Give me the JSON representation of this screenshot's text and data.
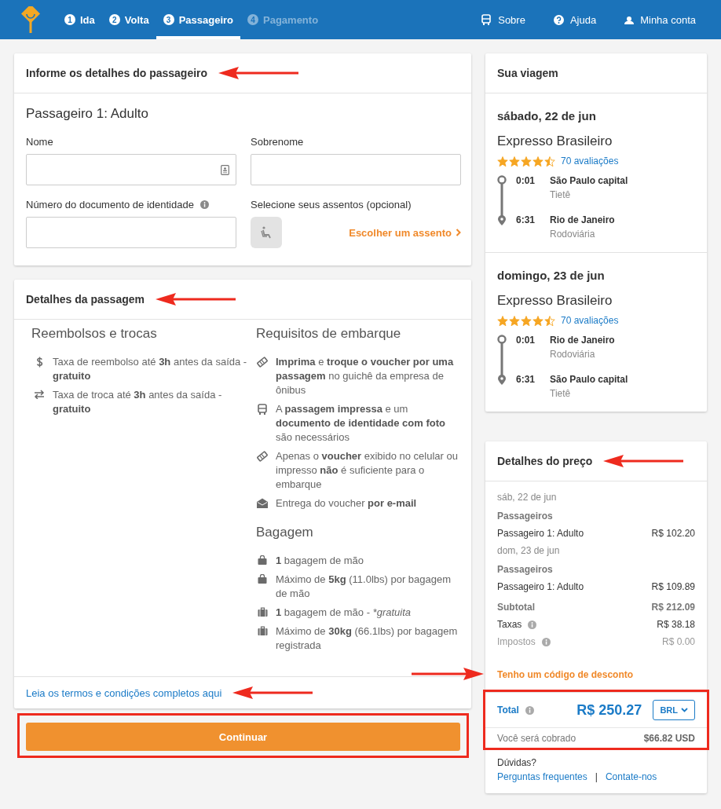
{
  "header": {
    "steps": [
      {
        "number": "1",
        "label": "Ida",
        "selected": false,
        "disabled": false
      },
      {
        "number": "2",
        "label": "Volta",
        "selected": false,
        "disabled": false
      },
      {
        "number": "3",
        "label": "Passageiro",
        "selected": true,
        "disabled": false
      },
      {
        "number": "4",
        "label": "Pagamento",
        "selected": false,
        "disabled": true
      }
    ],
    "links": [
      {
        "kind": "bus",
        "label": "Sobre"
      },
      {
        "kind": "help",
        "label": "Ajuda"
      },
      {
        "kind": "user",
        "label": "Minha conta"
      }
    ]
  },
  "passenger_form": {
    "title": "Informe os detalhes do passageiro",
    "passenger": "Passageiro 1: Adulto",
    "fields": [
      {
        "kind": "contact",
        "label": "Nome"
      },
      {
        "kind": "plain",
        "label": "Sobrenome"
      },
      {
        "kind": "info",
        "label": "Número do documento de identidade"
      }
    ],
    "seats": {
      "label": "Selecione seus assentos (opcional)",
      "link": "Escolher um assento"
    }
  },
  "ticket_details": {
    "title": "Detalhes da passagem",
    "columns": [
      [
        {
          "heading": "Reembolsos e trocas",
          "items": [
            {
              "kind": "dollar",
              "text": "Taxa de reembolso até **3h** antes da saída - **gratuito**"
            },
            {
              "kind": "swap",
              "text": "Taxa de troca até **3h** antes da saída - **gratuito**"
            }
          ]
        }
      ],
      [
        {
          "heading": "Requisitos de embarque",
          "items": [
            {
              "kind": "ticket",
              "text": "**Imprima** e **troque o voucher por uma passagem** no guichê da empresa de ônibus"
            },
            {
              "kind": "bus",
              "text": "A **passagem impressa** e um **documento de identidade com foto** são necessários"
            },
            {
              "kind": "ticket",
              "text": "Apenas o **voucher** exibido no celular ou impresso **não** é suficiente para o embarque"
            },
            {
              "kind": "mail",
              "text": "Entrega do voucher **por e-mail**"
            }
          ]
        },
        {
          "heading": "Bagagem",
          "items": [
            {
              "kind": "bag",
              "text": "**1** bagagem de mão"
            },
            {
              "kind": "bag",
              "text": "Máximo de **5kg** (11.0lbs) por bagagem de mão"
            },
            {
              "kind": "suitcase",
              "text": "**1** bagagem de mão -",
              "note": "*gratuita"
            },
            {
              "kind": "suitcase",
              "text": "Máximo de **30kg** (66.1lbs) por bagagem registrada"
            }
          ]
        }
      ]
    ],
    "terms_link": "Leia os termos e condições completos aqui"
  },
  "continue_button": "Continuar",
  "trip": {
    "title": "Sua viagem",
    "legs": [
      {
        "date": "sábado, 22 de jun",
        "company": "Expresso Brasileiro",
        "stars": 4.5,
        "reviews": "70 avaliações",
        "stops": [
          {
            "time": "0:01",
            "city": "São Paulo capital",
            "station": "Tietê"
          },
          {
            "time": "6:31",
            "city": "Rio de Janeiro",
            "station": "Rodoviária"
          }
        ]
      },
      {
        "date": "domingo, 23 de jun",
        "company": "Expresso Brasileiro",
        "stars": 4.5,
        "reviews": "70 avaliações",
        "stops": [
          {
            "time": "0:01",
            "city": "Rio de Janeiro",
            "station": "Rodoviária"
          },
          {
            "time": "6:31",
            "city": "São Paulo capital",
            "station": "Tietê"
          }
        ]
      }
    ]
  },
  "price": {
    "title": "Detalhes do preço",
    "days": [
      {
        "date": "sáb, 22 de jun",
        "group": "Passageiros",
        "lines": [
          {
            "label": "Passageiro 1: Adulto",
            "amount": "R$ 102.20"
          }
        ]
      },
      {
        "date": "dom, 23 de jun",
        "group": "Passageiros",
        "lines": [
          {
            "label": "Passageiro 1: Adulto",
            "amount": "R$ 109.89"
          }
        ]
      }
    ],
    "summary": [
      {
        "kind": "strong",
        "label": "Subtotal",
        "amount": "R$ 212.09",
        "info": false
      },
      {
        "kind": "normal",
        "label": "Taxas",
        "amount": "R$ 38.18",
        "info": true
      },
      {
        "kind": "muted",
        "label": "Impostos",
        "amount": "R$ 0.00",
        "info": true
      }
    ],
    "discount_link": "Tenho um código de desconto",
    "total": {
      "label": "Total",
      "info": true,
      "amount": "R$ 250.27",
      "currency": "BRL",
      "charged_label": "Você será cobrado",
      "charged_amount": "$66.82 USD"
    },
    "help": {
      "question": "Dúvidas?",
      "links": [
        "Perguntas frequentes",
        "Contate-nos"
      ],
      "separator": "|"
    }
  }
}
